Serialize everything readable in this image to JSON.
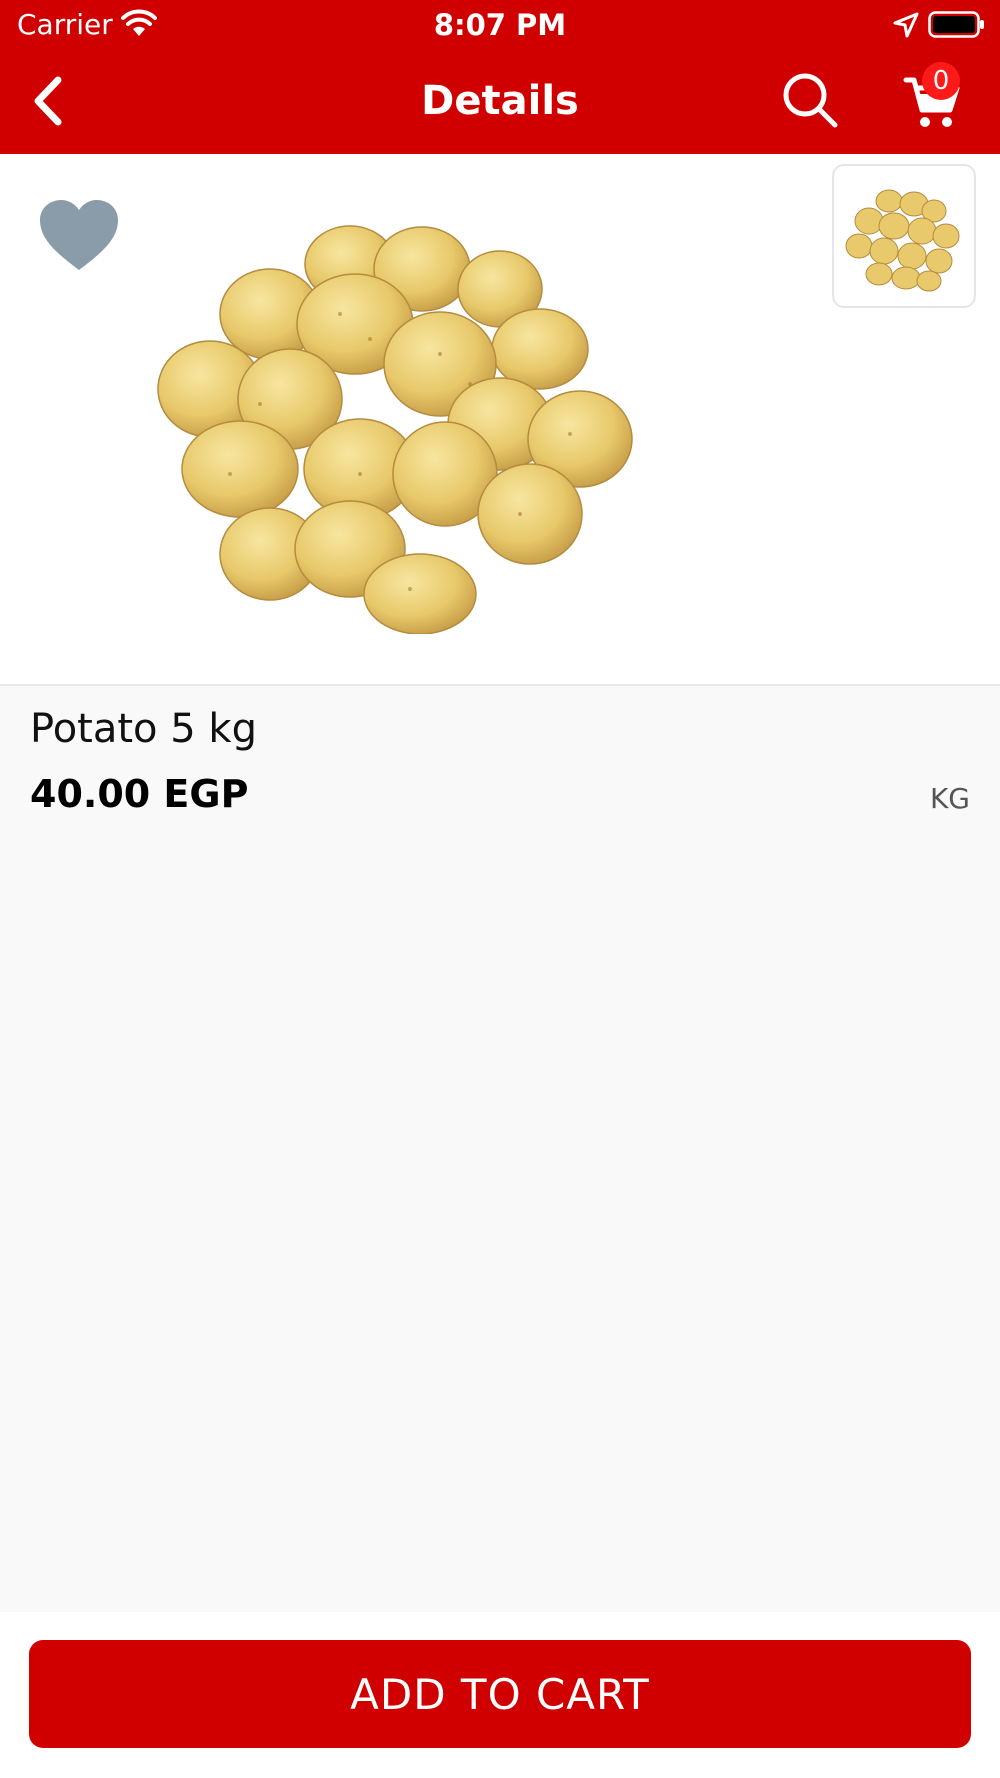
{
  "status_bar": {
    "carrier": "Carrier",
    "time": "8:07 PM"
  },
  "nav": {
    "title": "Details",
    "cart_count": "0"
  },
  "product": {
    "name": "Potato 5 kg",
    "price": "40.00 EGP",
    "unit": "KG"
  },
  "actions": {
    "add_to_cart_label": "ADD TO CART"
  },
  "colors": {
    "brand_red": "#d10000",
    "badge_red": "#ff1a1a",
    "favorite_gray": "#8a9caa",
    "background": "#f9f9f9"
  },
  "icons": {
    "back": "chevron-left-icon",
    "search": "search-icon",
    "cart": "shopping-cart-icon",
    "favorite": "heart-icon",
    "wifi": "wifi-icon",
    "location": "location-arrow-icon",
    "battery": "battery-icon"
  }
}
